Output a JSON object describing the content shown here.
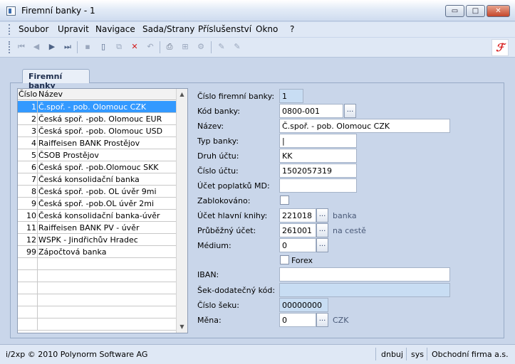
{
  "window": {
    "title": "Firemní banky - 1"
  },
  "menu": [
    "Soubor",
    "Upravit",
    "Navigace",
    "Sada/Strany",
    "Příslušenství",
    "Okno",
    "?"
  ],
  "tab": {
    "label": "Firemní banky"
  },
  "list": {
    "headers": {
      "number": "Číslo",
      "name": "Název"
    },
    "rows": [
      {
        "n": "1",
        "t": "Č.spoř. - pob. Olomouc  CZK"
      },
      {
        "n": "2",
        "t": "Česká spoř. -pob. Olomouc EUR"
      },
      {
        "n": "3",
        "t": "Česká spoř. -pob. Olomouc USD"
      },
      {
        "n": "4",
        "t": "Raiffeisen BANK Prostějov"
      },
      {
        "n": "5",
        "t": "ČSOB Prostějov"
      },
      {
        "n": "6",
        "t": "Česká spoř. -pob.Olomouc  SKK"
      },
      {
        "n": "7",
        "t": "Česká konsolidační banka"
      },
      {
        "n": "8",
        "t": "Česká spoř. -pob. OL  úvěr 9mi"
      },
      {
        "n": "9",
        "t": "Česká spoř. -pob.OL  úvěr 2mi"
      },
      {
        "n": "10",
        "t": "Česká konsolidační banka-úvěr"
      },
      {
        "n": "11",
        "t": "Raiffeisen BANK PV - úvěr"
      },
      {
        "n": "12",
        "t": "WSPK - Jindřichův Hradec"
      },
      {
        "n": "99",
        "t": "Zápočtová banka"
      }
    ]
  },
  "form": {
    "cislo_firemni_banky": {
      "label": "Číslo firemní banky:",
      "value": "1"
    },
    "kod_banky": {
      "label": "Kód banky:",
      "value": "0800-001"
    },
    "nazev": {
      "label": "Název:",
      "value": "Č.spoř. - pob. Olomouc  CZK"
    },
    "typ_banky": {
      "label": "Typ banky:",
      "value": "|"
    },
    "druh_uctu": {
      "label": "Druh účtu:",
      "value": "KK"
    },
    "cislo_uctu": {
      "label": "Číslo účtu:",
      "value": "1502057319"
    },
    "ucet_poplatku": {
      "label": "Účet poplatků MD:",
      "value": ""
    },
    "zablokovano": {
      "label": "Zablokováno:"
    },
    "ucet_hlavni_knihy": {
      "label": "Účet hlavní knihy:",
      "value": "221018",
      "hint": "banka"
    },
    "prubezny_ucet": {
      "label": "Průběžný účet:",
      "value": "261001",
      "hint": "na cestě"
    },
    "medium": {
      "label": "Médium:",
      "value": "0"
    },
    "forex": {
      "label": "Forex"
    },
    "iban": {
      "label": "IBAN:",
      "value": ""
    },
    "sek_kod": {
      "label": "Šek-dodatečný kód:",
      "value": ""
    },
    "cislo_seku": {
      "label": "Číslo šeku:",
      "value": "00000000"
    },
    "mena": {
      "label": "Měna:",
      "value": "0",
      "hint": "CZK"
    },
    "dots": "..."
  },
  "status": {
    "copyright": "i/2xp © 2010 Polynorm Software AG",
    "user": "dnbuj",
    "db": "sys",
    "firm": "Obchodní firma a.s."
  },
  "win_buttons": {
    "min": "▭",
    "max": "□",
    "close": "✕"
  },
  "logo": "ℱ"
}
